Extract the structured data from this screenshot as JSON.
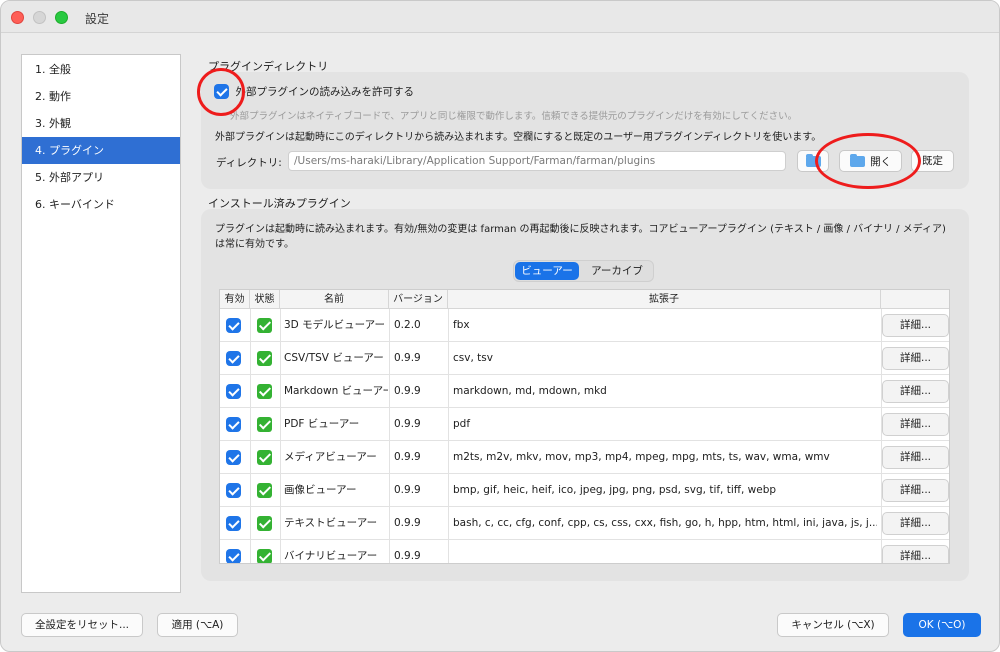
{
  "window": {
    "title": "設定"
  },
  "sidebar": {
    "items": [
      {
        "label": "1. 全般"
      },
      {
        "label": "2. 動作"
      },
      {
        "label": "3. 外観"
      },
      {
        "label": "4. プラグイン"
      },
      {
        "label": "5. 外部アプリ"
      },
      {
        "label": "6. キーバインド"
      }
    ],
    "selected": "4. プラグイン"
  },
  "plugin_dir": {
    "section_title": "プラグインディレクトリ",
    "allow_checkbox_label": "外部プラグインの読み込みを許可する",
    "allow_checked": true,
    "help_text": "外部プラグインはネイティブコードで、アプリと同じ権限で動作します。信頼できる提供元のプラグインだけを有効にしてください。",
    "info_text": "外部プラグインは起動時にこのディレクトリから読み込まれます。空欄にすると既定のユーザー用プラグインディレクトリを使います。",
    "directory_label": "ディレクトリ:",
    "directory_value": "/Users/ms-haraki/Library/Application Support/Farman/farman/plugins",
    "open_label": "開く",
    "default_label": "既定"
  },
  "installed": {
    "section_title": "インストール済みプラグイン",
    "description": "プラグインは起動時に読み込まれます。有効/無効の変更は farman の再起動後に反映されます。コアビューアープラグイン (テキスト / 画像 / バイナリ / メディア) は常に有効です。",
    "tabs": [
      {
        "label": "ビューアー"
      },
      {
        "label": "アーカイブ"
      }
    ],
    "active_tab": "ビューアー",
    "columns": [
      "有効",
      "状態",
      "名前",
      "バージョン",
      "拡張子",
      ""
    ],
    "detail_label": "詳細...",
    "rows": [
      {
        "enabled": true,
        "name": "3D モデルビューアー",
        "version": "0.2.0",
        "extensions": "fbx"
      },
      {
        "enabled": true,
        "name": "CSV/TSV ビューアー",
        "version": "0.9.9",
        "extensions": "csv, tsv"
      },
      {
        "enabled": true,
        "name": "Markdown ビューアー",
        "version": "0.9.9",
        "extensions": "markdown, md, mdown, mkd"
      },
      {
        "enabled": true,
        "name": "PDF ビューアー",
        "version": "0.9.9",
        "extensions": "pdf"
      },
      {
        "enabled": true,
        "name": "メディアビューアー",
        "version": "0.9.9",
        "extensions": "m2ts, m2v, mkv, mov, mp3, mp4, mpeg, mpg, mts, ts, wav, wma, wmv"
      },
      {
        "enabled": true,
        "name": "画像ビューアー",
        "version": "0.9.9",
        "extensions": "bmp, gif, heic, heif, ico, jpeg, jpg, png, psd, svg, tif, tiff, webp"
      },
      {
        "enabled": true,
        "name": "テキストビューアー",
        "version": "0.9.9",
        "extensions": "bash, c, cc, cfg, conf, cpp, cs, css, cxx, fish, go, h, hpp, htm, html, ini, java, js, j..."
      },
      {
        "enabled": true,
        "name": "バイナリビューアー",
        "version": "0.9.9",
        "extensions": ""
      }
    ]
  },
  "footer": {
    "reset_label": "全設定をリセット...",
    "apply_label": "適用 (⌥A)",
    "cancel_label": "キャンセル (⌥X)",
    "ok_label": "OK (⌥O)"
  },
  "colors": {
    "accent": "#1a73e8",
    "annotation": "#ee1c1c",
    "status_ok": "#34b233"
  }
}
